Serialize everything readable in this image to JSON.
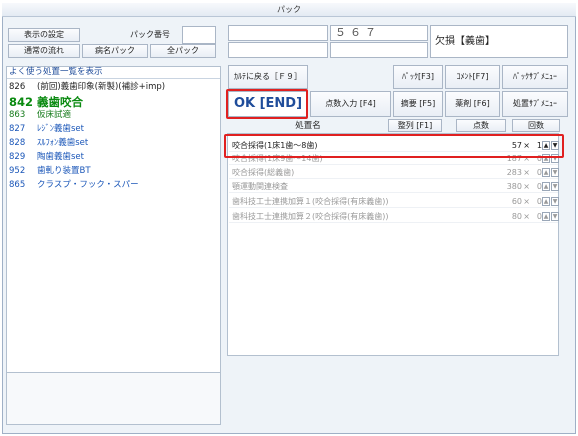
{
  "window": {
    "title": "パック"
  },
  "top_left": {
    "settings": "表示の設定",
    "pack_no_label": "パック番号",
    "normal_flow": "通常の流れ",
    "disease_pack": "病名パック",
    "all_pack": "全パック"
  },
  "top_right": {
    "number": "５６７",
    "status": "欠損【義歯】"
  },
  "toolbar": {
    "back": "ｶﾙﾃに戻る［Ｆ９］",
    "pack_f3": "ﾊﾟｯｸ[F3]",
    "comment_f7": "ｺﾒﾝﾄ[F7]",
    "pack_sub_menu": "ﾊﾟｯｸｻﾌﾞﾒﾆｭｰ",
    "ok_end": "OK [END]",
    "points_input": "点数入力 [F4]",
    "summary_f5": "摘要 [F5]",
    "drug_f6": "薬剤 [F6]",
    "treatment_sub_menu": "処置ｻﾌﾞﾒﾆｭｰ"
  },
  "columns": {
    "name": "処置名",
    "sort": "整列 [F1]",
    "points": "点数",
    "count": "回数"
  },
  "left_panel": {
    "header": "よく使う処置一覧を表示",
    "items": [
      {
        "code": "826",
        "name": "(前回)義歯印象(新製)(補診+imp)"
      },
      {
        "code": "842",
        "name": "義歯咬合"
      },
      {
        "code": "863",
        "name": "仮床試適"
      },
      {
        "code": "827",
        "name": "ﾚｼﾞﾝ義歯set"
      },
      {
        "code": "828",
        "name": "ｽﾙﾌｫﾝ義歯set"
      },
      {
        "code": "829",
        "name": "陶歯義歯set"
      },
      {
        "code": "952",
        "name": "歯軋り装置BT"
      },
      {
        "code": "865",
        "name": "クラスプ・フック・スパー"
      }
    ]
  },
  "rows": [
    {
      "name": "咬合採得(1床1歯～8歯)",
      "points": "57",
      "qty": "1"
    },
    {
      "name": "咬合採得(1床9歯～14歯)",
      "points": "187",
      "qty": "0"
    },
    {
      "name": "咬合採得(総義歯)",
      "points": "283",
      "qty": "0"
    },
    {
      "name": "顎運動関連検査",
      "points": "380",
      "qty": "0"
    },
    {
      "name": "歯科技工士連携加算１(咬合採得(有床義歯))",
      "points": "60",
      "qty": "0"
    },
    {
      "name": "歯科技工士連携加算２(咬合採得(有床義歯))",
      "points": "80",
      "qty": "0"
    }
  ],
  "times_sign": "×",
  "arrows": {
    "up": "▲",
    "down": "▼"
  },
  "colors": {
    "highlight": "#e02020",
    "ok_text": "#1f4c9a",
    "green_item": "#157a1a",
    "blue_item": "#1a56b8"
  }
}
